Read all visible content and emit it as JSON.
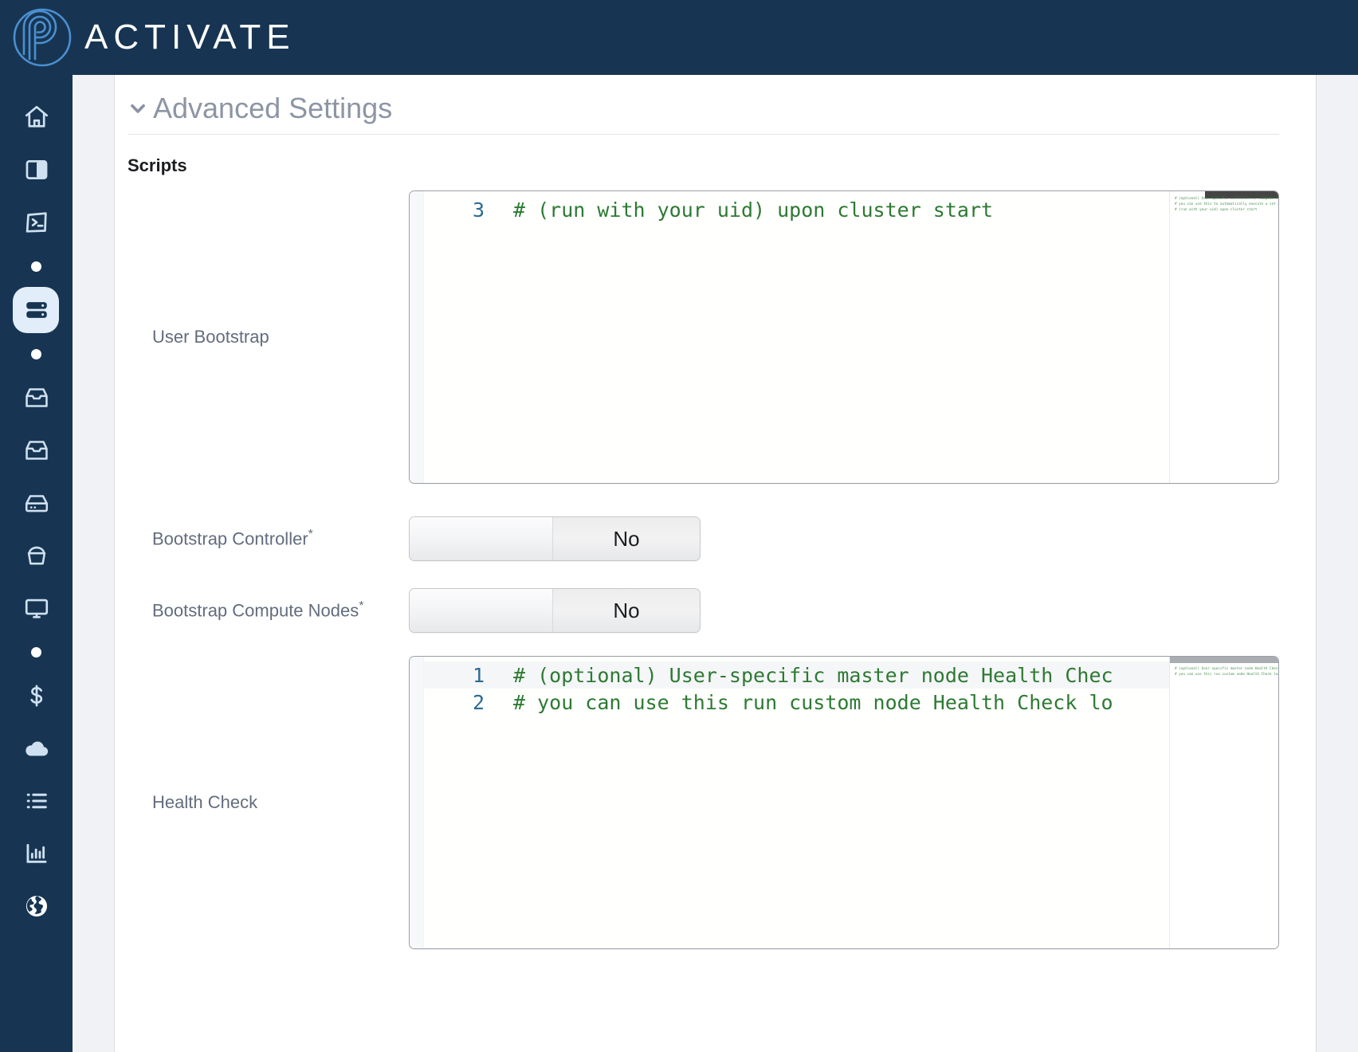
{
  "header": {
    "brand": "ACTIVATE",
    "logo_icon": "activate-fingerprint-logo",
    "brand_color": "#4a8fd0",
    "bar_color": "#173552"
  },
  "sidebar": {
    "items": [
      {
        "icon": "home-icon",
        "name": "home",
        "active": false,
        "type": "icon"
      },
      {
        "icon": "panel-icon",
        "name": "dashboard-panel",
        "active": false,
        "type": "icon"
      },
      {
        "icon": "terminal-icon",
        "name": "terminal",
        "active": false,
        "type": "icon"
      },
      {
        "icon": "dot-icon",
        "name": "separator-dot-1",
        "active": false,
        "type": "dot"
      },
      {
        "icon": "server-icon",
        "name": "clusters",
        "active": true,
        "type": "icon"
      },
      {
        "icon": "dot-icon",
        "name": "separator-dot-2",
        "active": false,
        "type": "dot"
      },
      {
        "icon": "inbox-icon",
        "name": "inbox-1",
        "active": false,
        "type": "icon"
      },
      {
        "icon": "inbox-icon",
        "name": "inbox-2",
        "active": false,
        "type": "icon"
      },
      {
        "icon": "harddrive-icon",
        "name": "storage",
        "active": false,
        "type": "icon"
      },
      {
        "icon": "bucket-icon",
        "name": "buckets",
        "active": false,
        "type": "icon"
      },
      {
        "icon": "monitor-icon",
        "name": "remote-desktop",
        "active": false,
        "type": "icon"
      },
      {
        "icon": "dot-icon",
        "name": "separator-dot-3",
        "active": false,
        "type": "dot"
      },
      {
        "icon": "dollar-icon",
        "name": "billing",
        "active": false,
        "type": "icon"
      },
      {
        "icon": "cloud-icon",
        "name": "cloud",
        "active": false,
        "type": "icon"
      },
      {
        "icon": "list-icon",
        "name": "jobs-list",
        "active": false,
        "type": "icon"
      },
      {
        "icon": "chart-icon",
        "name": "reports",
        "active": false,
        "type": "icon"
      },
      {
        "icon": "globe-icon",
        "name": "region",
        "active": false,
        "type": "icon"
      }
    ]
  },
  "main": {
    "section": {
      "title": "Advanced Settings",
      "chevron_icon": "chevron-down-icon",
      "expanded": true
    },
    "subsection_title": "Scripts",
    "fields": {
      "user_bootstrap": {
        "label": "User Bootstrap",
        "required": false,
        "editor": {
          "lines": [
            {
              "num": "3",
              "text": "# (run with your uid) upon cluster start",
              "highlighted": false
            }
          ],
          "minimap_lines": [
            "# (optional) User-specific controller or compute nodes",
            "# you can use this to automatically execute a set of co",
            "# (run with your uid) upon cluster start"
          ]
        }
      },
      "bootstrap_controller": {
        "label": "Bootstrap Controller",
        "required": true,
        "required_mark": "*",
        "value": "No"
      },
      "bootstrap_compute_nodes": {
        "label": "Bootstrap Compute Nodes",
        "required": true,
        "required_mark": "*",
        "value": "No"
      },
      "health_check": {
        "label": "Health Check",
        "required": false,
        "editor": {
          "lines": [
            {
              "num": "1",
              "text": "# (optional) User-specific master node Health Chec",
              "highlighted": true
            },
            {
              "num": "2",
              "text": "# you can use this run custom node Health Check lo",
              "highlighted": false
            }
          ],
          "minimap_lines": [
            "# (optional) User-specific master node Health Check",
            "# you can use this run custom node Health Check logic"
          ]
        }
      }
    }
  },
  "colors": {
    "navy": "#173552",
    "accent_blue": "#4a8fd0",
    "active_pill": "#e1edf8",
    "code_green": "#2d7a33",
    "line_number_blue": "#2d6b93",
    "label_gray": "#636c7d",
    "section_gray": "#8d95a5"
  }
}
